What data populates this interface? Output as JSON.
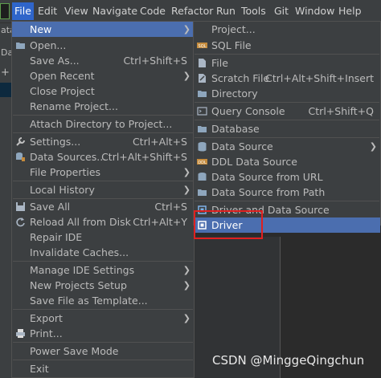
{
  "menubar": {
    "items": [
      "File",
      "Edit",
      "View",
      "Navigate",
      "Code",
      "Refactor",
      "Run",
      "Tools",
      "Git",
      "Window",
      "Help"
    ]
  },
  "background": {
    "left_fragments": [
      "ata",
      "Da",
      "+"
    ],
    "watermark": "CSDN @MinggeQingchun"
  },
  "file_menu": {
    "items": [
      {
        "label": "New",
        "shortcut": "",
        "submenu": true,
        "selected": true
      },
      {
        "label": "Open...",
        "shortcut": "",
        "icon": "folder-icon"
      },
      {
        "label": "Save As...",
        "shortcut": "Ctrl+Shift+S"
      },
      {
        "label": "Open Recent",
        "shortcut": "",
        "submenu": true
      },
      {
        "label": "Close Project",
        "shortcut": ""
      },
      {
        "label": "Rename Project...",
        "shortcut": ""
      },
      {
        "label": "Attach Directory to Project...",
        "shortcut": ""
      },
      {
        "label": "Settings...",
        "shortcut": "Ctrl+Alt+S",
        "icon": "wrench-icon"
      },
      {
        "label": "Data Sources...",
        "shortcut": "Ctrl+Alt+Shift+S",
        "icon": "data-sources-icon"
      },
      {
        "label": "File Properties",
        "shortcut": "",
        "submenu": true
      },
      {
        "label": "Local History",
        "shortcut": "",
        "submenu": true
      },
      {
        "label": "Save All",
        "shortcut": "Ctrl+S",
        "icon": "save-icon"
      },
      {
        "label": "Reload All from Disk",
        "shortcut": "Ctrl+Alt+Y",
        "icon": "reload-icon"
      },
      {
        "label": "Repair IDE",
        "shortcut": ""
      },
      {
        "label": "Invalidate Caches...",
        "shortcut": ""
      },
      {
        "label": "Manage IDE Settings",
        "shortcut": "",
        "submenu": true
      },
      {
        "label": "New Projects Setup",
        "shortcut": "",
        "submenu": true
      },
      {
        "label": "Save File as Template...",
        "shortcut": ""
      },
      {
        "label": "Export",
        "shortcut": "",
        "submenu": true
      },
      {
        "label": "Print...",
        "shortcut": "",
        "icon": "print-icon"
      },
      {
        "label": "Power Save Mode",
        "shortcut": ""
      },
      {
        "label": "Exit",
        "shortcut": ""
      }
    ]
  },
  "new_menu": {
    "items": [
      {
        "label": "Project...",
        "shortcut": ""
      },
      {
        "label": "SQL File",
        "shortcut": "",
        "icon": "sql-file-icon"
      },
      {
        "label": "File",
        "shortcut": "",
        "icon": "file-icon"
      },
      {
        "label": "Scratch File",
        "shortcut": "Ctrl+Alt+Shift+Insert",
        "icon": "scratch-file-icon"
      },
      {
        "label": "Directory",
        "shortcut": "",
        "icon": "directory-icon"
      },
      {
        "label": "Query Console",
        "shortcut": "Ctrl+Shift+Q",
        "icon": "query-console-icon"
      },
      {
        "label": "Database",
        "shortcut": "",
        "icon": "database-icon"
      },
      {
        "label": "Data Source",
        "shortcut": "",
        "submenu": true,
        "icon": "data-source-icon"
      },
      {
        "label": "DDL Data Source",
        "shortcut": "",
        "icon": "ddl-data-source-icon"
      },
      {
        "label": "Data Source from URL",
        "shortcut": "",
        "icon": "data-source-url-icon"
      },
      {
        "label": "Data Source from Path",
        "shortcut": "",
        "icon": "data-source-path-icon"
      },
      {
        "label": "Driver and Data Source",
        "shortcut": "",
        "icon": "driver-data-source-icon"
      },
      {
        "label": "Driver",
        "shortcut": "",
        "icon": "driver-icon",
        "selected": true
      }
    ]
  },
  "colors": {
    "menu_bg": "#3c3f41",
    "selection": "#4b6eaf",
    "active_top": "#2f65ca",
    "highlight_box": "#e02020"
  }
}
